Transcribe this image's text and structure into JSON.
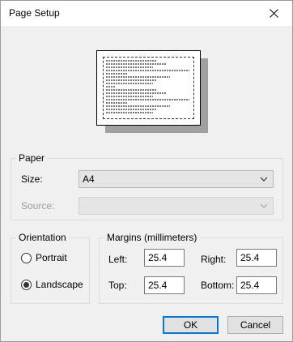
{
  "window": {
    "title": "Page Setup"
  },
  "paper": {
    "group_label": "Paper",
    "size_label": "Size:",
    "size_value": "A4",
    "source_label": "Source:",
    "source_value": ""
  },
  "orientation": {
    "group_label": "Orientation",
    "portrait_label": "Portrait",
    "landscape_label": "Landscape",
    "selected": "Landscape"
  },
  "margins": {
    "group_label": "Margins (millimeters)",
    "left_label": "Left:",
    "left_value": "25.4",
    "right_label": "Right:",
    "right_value": "25.4",
    "top_label": "Top:",
    "top_value": "25.4",
    "bottom_label": "Bottom:",
    "bottom_value": "25.4"
  },
  "buttons": {
    "ok_label": "OK",
    "cancel_label": "Cancel"
  }
}
